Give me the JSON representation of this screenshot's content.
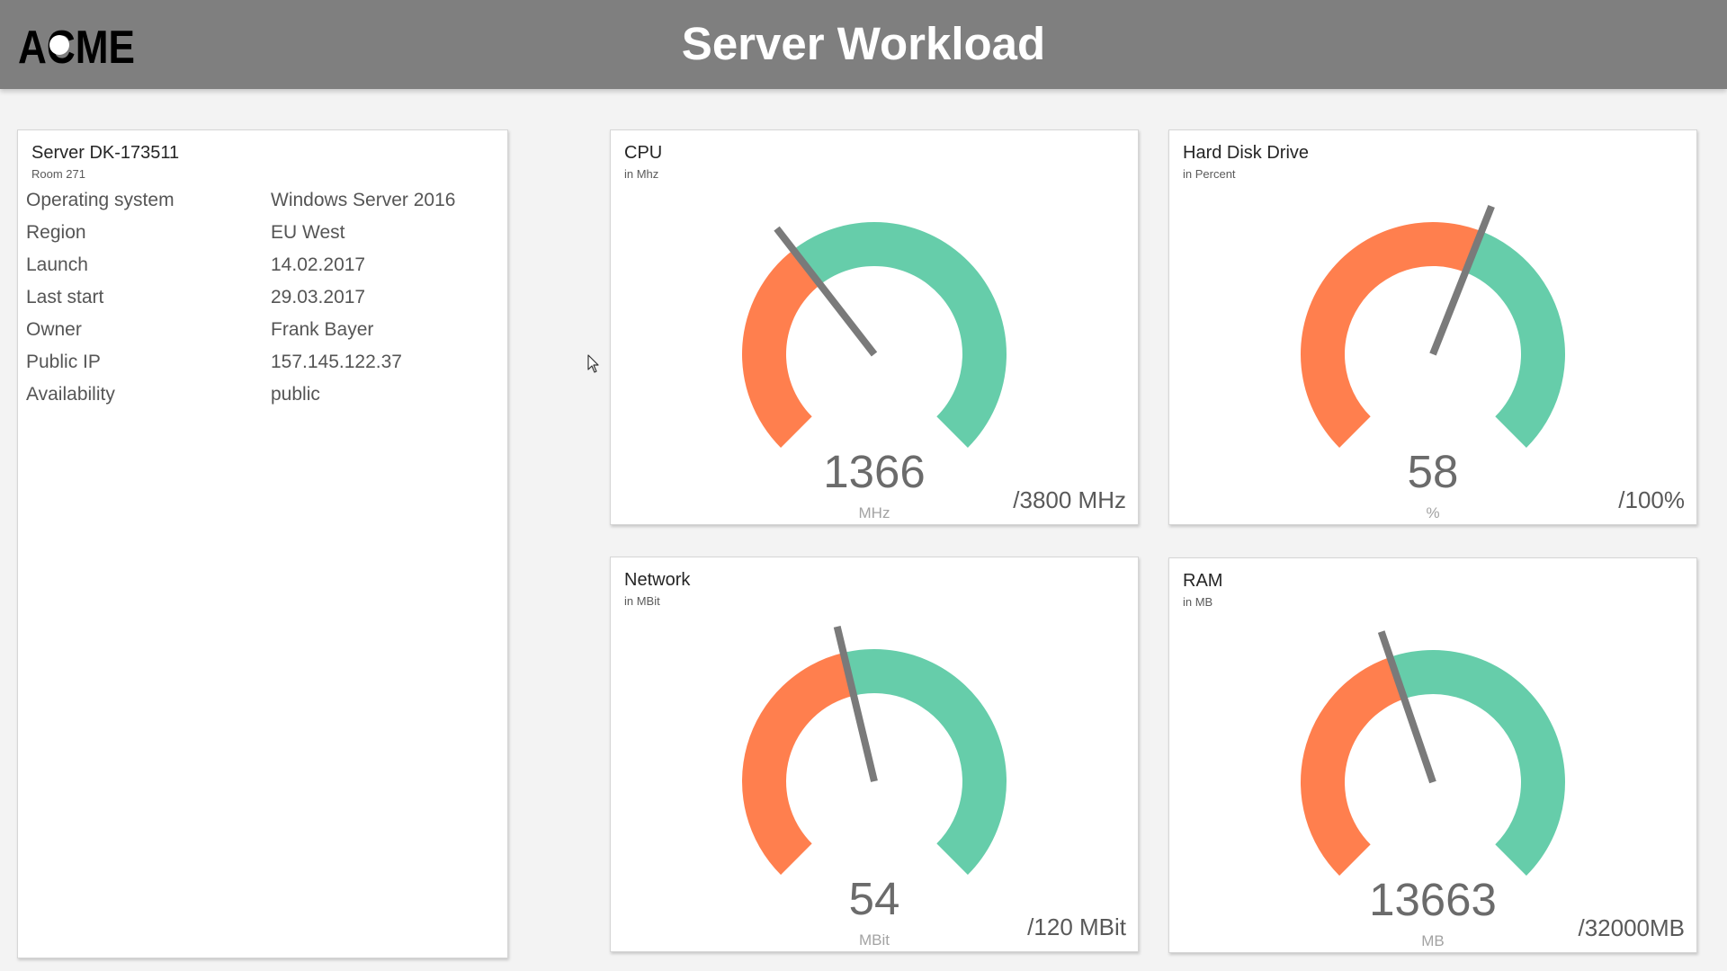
{
  "header": {
    "logo_text": "ACME",
    "title": "Server Workload"
  },
  "server": {
    "name": "Server DK-173511",
    "room": "Room 271",
    "rows": [
      {
        "label": "Operating system",
        "value": "Windows Server 2016"
      },
      {
        "label": "Region",
        "value": "EU West"
      },
      {
        "label": "Launch",
        "value": "14.02.2017"
      },
      {
        "label": "Last start",
        "value": "29.03.2017"
      },
      {
        "label": "Owner",
        "value": "Frank Bayer"
      },
      {
        "label": "Public IP",
        "value": "157.145.122.37"
      },
      {
        "label": "Availability",
        "value": "public"
      }
    ]
  },
  "gauges": [
    {
      "title": "CPU",
      "subtitle": "in Mhz",
      "value": "1366",
      "unit": "MHz",
      "max_label": "/3800 MHz",
      "fraction": 0.36
    },
    {
      "title": "Hard Disk Drive",
      "subtitle": "in Percent",
      "value": "58",
      "unit": "%",
      "max_label": "/100%",
      "fraction": 0.58
    },
    {
      "title": "Network",
      "subtitle": "in MBit",
      "value": "54",
      "unit": "MBit",
      "max_label": "/120 MBit",
      "fraction": 0.45
    },
    {
      "title": "RAM",
      "subtitle": "in MB",
      "value": "13663",
      "unit": "MB",
      "max_label": "/32000MB",
      "fraction": 0.43
    }
  ],
  "colors": {
    "header_bg": "#7f7f7f",
    "used": "#ff7f4e",
    "free": "#66cdaa",
    "needle": "#7a7a7a"
  },
  "icons": {
    "cursor": "mouse-pointer-icon"
  }
}
